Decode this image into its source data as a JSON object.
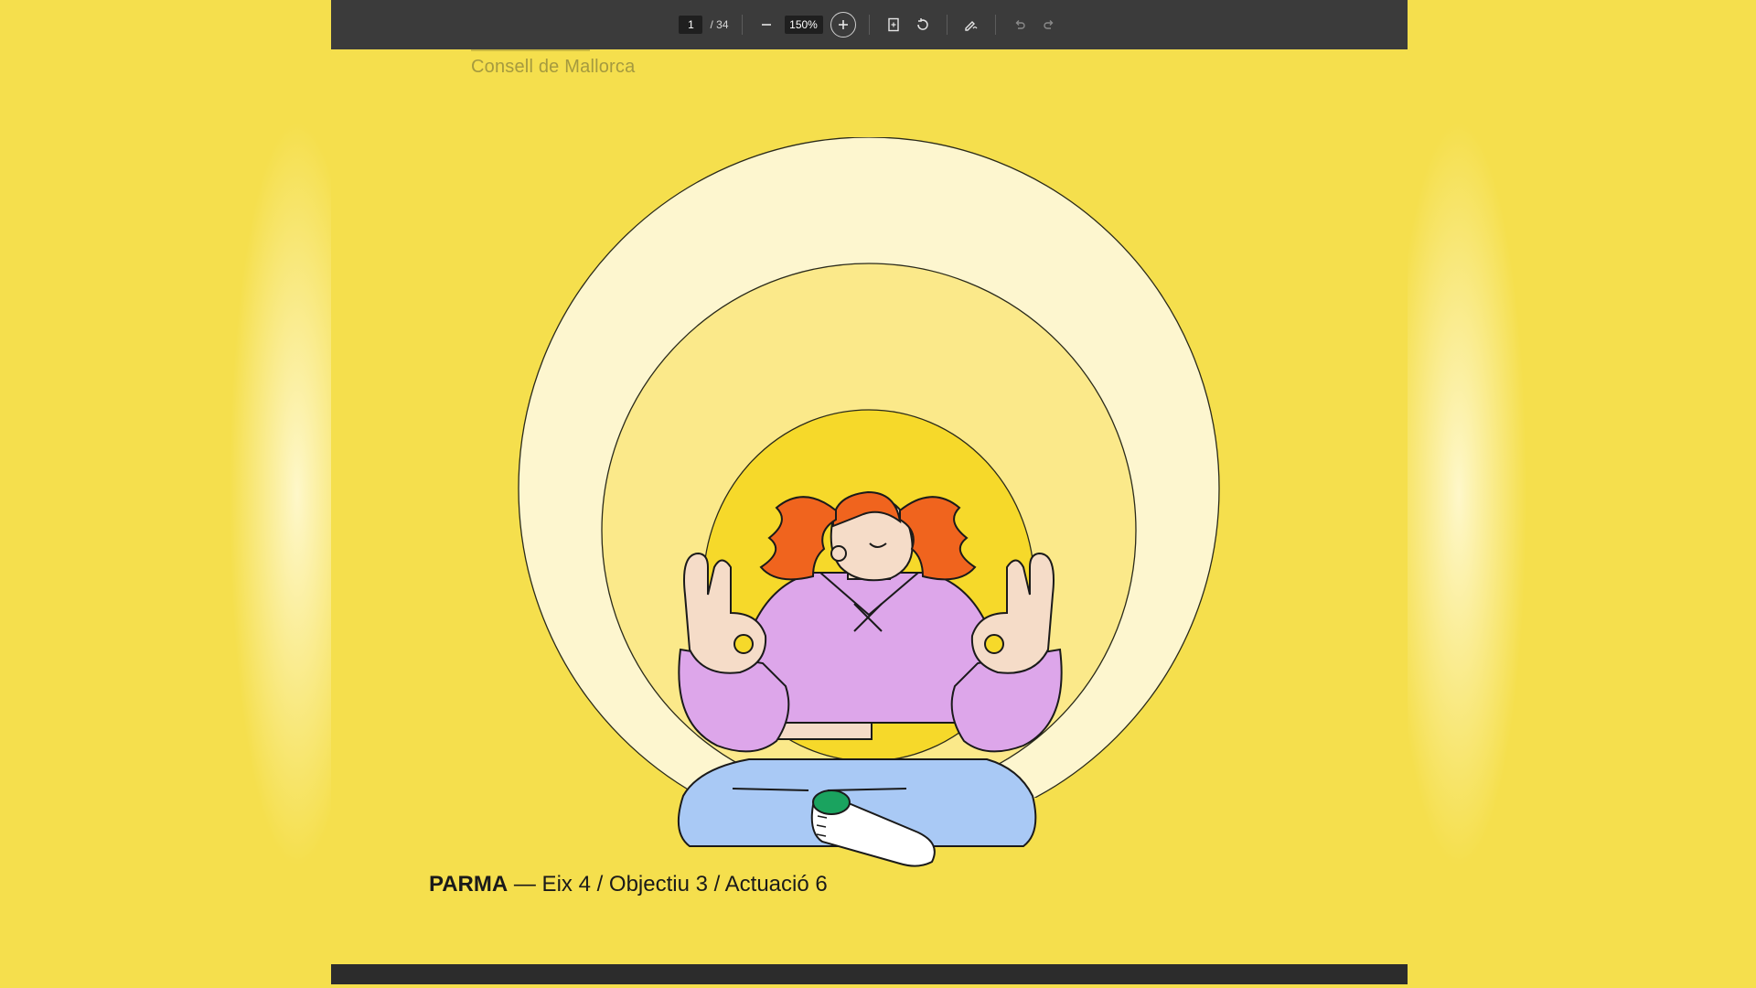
{
  "toolbar": {
    "page_current": "1",
    "page_total": "/ 34",
    "zoom_level": "150%",
    "zoom_out_icon": "minus-icon",
    "zoom_in_icon": "plus-circle-icon",
    "fit_page_icon": "fit-page-icon",
    "rotate_icon": "rotate-icon",
    "annotate_icon": "draw-icon",
    "undo_icon": "undo-icon",
    "redo_icon": "redo-icon"
  },
  "document": {
    "publisher": "Consell de Mallorca",
    "caption_bold": "PARMA",
    "caption_rest": " — Eix 4 / Objectiu 3 / Actuació 6"
  },
  "colors": {
    "background": "#f5df4d",
    "toolbar": "#3b3b3b",
    "halo_outer": "#fdf6cf",
    "halo_middle": "#fbe98a",
    "halo_inner": "#f6d92a",
    "hair": "#f0641e",
    "sweater": "#dda6ea",
    "pants": "#a9c9f5",
    "skin": "#f5dcc8",
    "sock_toe": "#1aa35f"
  }
}
